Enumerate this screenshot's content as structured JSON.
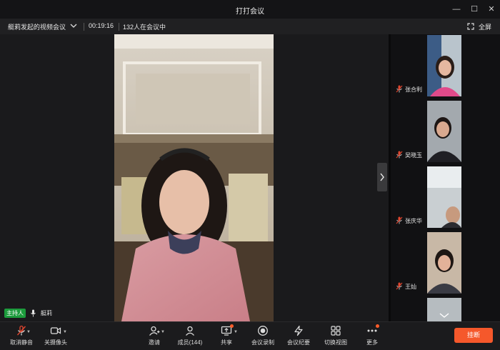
{
  "window": {
    "title": "打打会议"
  },
  "info": {
    "meeting_name": "艇莉发起的视频会议",
    "timer": "00:19:16",
    "participants": "132人在会议中",
    "fullscreen": "全屏"
  },
  "host": {
    "badge": "主持人",
    "name": "艇莉"
  },
  "participants": [
    {
      "name": "张合利"
    },
    {
      "name": "吴晓玉"
    },
    {
      "name": "张庆华"
    },
    {
      "name": "王灿"
    }
  ],
  "toolbar": {
    "unmute": "取消静音",
    "camera": "关摄像头",
    "invite": "邀请",
    "members": "成员(144)",
    "share": "共享",
    "record": "会议录制",
    "minutes": "会议纪要",
    "switch_view": "切换视图",
    "more": "更多",
    "hangup": "挂断"
  },
  "colors": {
    "accent": "#f5582b",
    "host_badge": "#1c9b3c",
    "muted": "#e0462f"
  }
}
